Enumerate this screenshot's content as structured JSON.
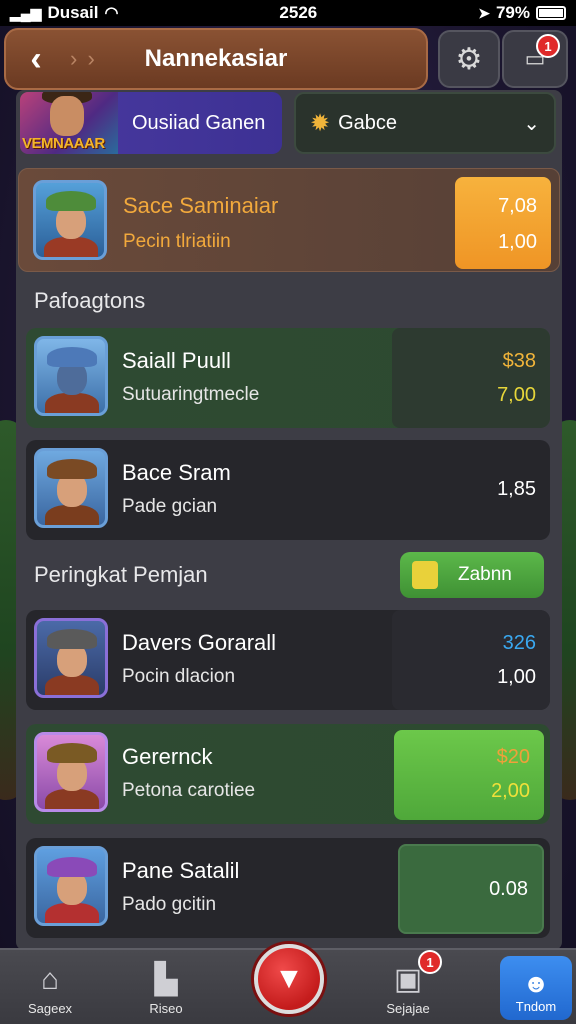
{
  "status_bar": {
    "carrier": "Dusail",
    "time": "2526",
    "battery": "79%"
  },
  "header": {
    "title": "Nannekasiar",
    "inbox_badge": "1"
  },
  "game_tile": {
    "logo": "VEMNAAAR",
    "label": "Ousiiad Ganen"
  },
  "selector": {
    "value": "Gabce"
  },
  "featured": {
    "name": "Sace Saminaiar",
    "subtitle": "Pecin tlriatiin",
    "score_top": "7,08",
    "score_bottom": "1,00"
  },
  "section_1": {
    "title": "Pafoagtons"
  },
  "section_1_rows": [
    {
      "name": "Saiall Puull",
      "subtitle": "Sutuaringtmecle",
      "score_top": "$38",
      "score_bottom": "7,00"
    },
    {
      "name": "Bace Sram",
      "subtitle": "Pade gcian",
      "score": "1,85"
    }
  ],
  "section_2": {
    "title": "Peringkat Pemjan",
    "button_label": "Zabnn"
  },
  "section_2_rows": [
    {
      "name": "Davers Gorarall",
      "subtitle": "Pocin dlacion",
      "score_top": "326",
      "score_bottom": "1,00"
    },
    {
      "name": "Gerernck",
      "subtitle": "Petona carotiee",
      "score_top": "$20",
      "score_bottom": "2,00"
    },
    {
      "name": "Pane Satalil",
      "subtitle": "Pado gcitin",
      "score": "0.08"
    }
  ],
  "bottom_nav": {
    "items": [
      "Sageex",
      "Riseo",
      "Sejajae",
      "Tndom"
    ],
    "badges": [
      "1"
    ]
  },
  "colors": {
    "accent_orange": "#f2a93c",
    "score_blue": "#3aa8f0",
    "score_yellow": "#e7c53a",
    "nav_active": "#2f7ae6"
  },
  "icons": [
    "back-icon",
    "forward-icon",
    "gear-icon",
    "inbox-icon",
    "gem-icon",
    "chevron-down-icon",
    "trophy-icon",
    "home-icon",
    "shop-icon",
    "play-icon",
    "chat-icon",
    "profile-icon"
  ]
}
